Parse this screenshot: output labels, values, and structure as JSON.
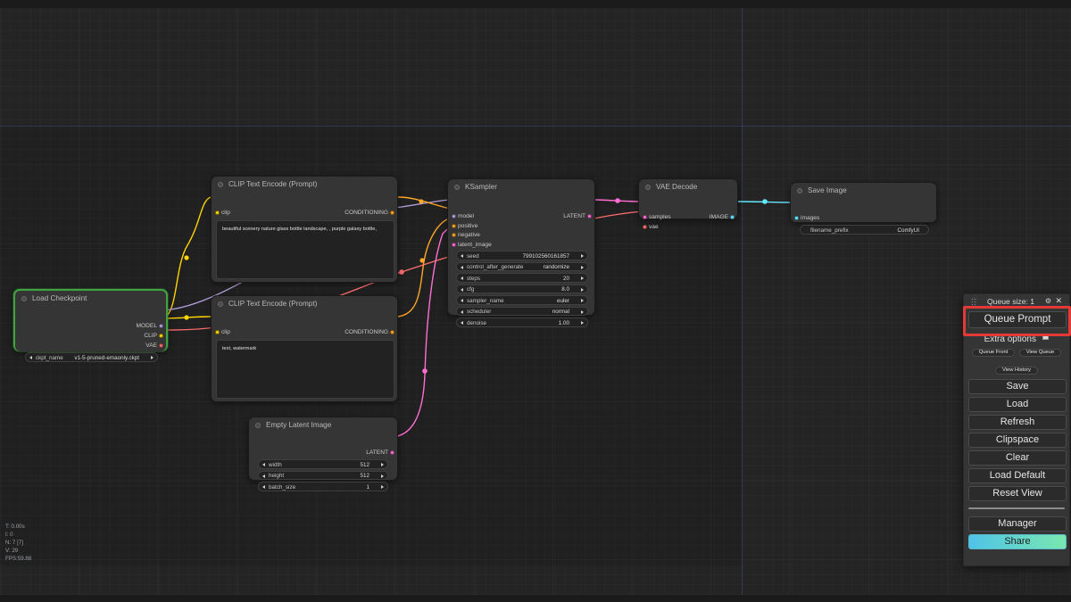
{
  "app": {
    "name": "ComfyUI"
  },
  "canvas": {
    "status": {
      "time": "T: 0.00s",
      "iterations": "I: 0",
      "nodes": "N: 7 [7]",
      "version": "V: 29",
      "fps": "FPS:59.88"
    }
  },
  "colors": {
    "model_link": "#b39ddb",
    "clip_link": "#ffd500",
    "vae_link": "#ff6e6e",
    "conditioning_link": "#ffa726",
    "latent_link": "#ff6ed4",
    "image_link": "#64e8ff",
    "selection": "#3fa33f",
    "highlight": "#e53935",
    "share_gradient_from": "#4fc3e8",
    "share_gradient_to": "#79e8b0"
  },
  "nodes": {
    "load_checkpoint": {
      "title": "Load Checkpoint",
      "outputs": [
        {
          "label": "MODEL",
          "color": "#b39ddb"
        },
        {
          "label": "CLIP",
          "color": "#ffd500"
        },
        {
          "label": "VAE",
          "color": "#ff6e6e"
        }
      ],
      "widgets": [
        {
          "label": "ckpt_name",
          "value": "v1-5-pruned-emaonly.ckpt"
        }
      ]
    },
    "clip_positive": {
      "title": "CLIP Text Encode (Prompt)",
      "inputs": [
        {
          "label": "clip",
          "color": "#ffd500"
        }
      ],
      "outputs": [
        {
          "label": "CONDITIONING",
          "color": "#ffa726"
        }
      ],
      "text": "beautiful scenery nature glass bottle landscape, , purple galaxy bottle,"
    },
    "clip_negative": {
      "title": "CLIP Text Encode (Prompt)",
      "inputs": [
        {
          "label": "clip",
          "color": "#ffd500"
        }
      ],
      "outputs": [
        {
          "label": "CONDITIONING",
          "color": "#ffa726"
        }
      ],
      "text": "text, watermark"
    },
    "empty_latent": {
      "title": "Empty Latent Image",
      "outputs": [
        {
          "label": "LATENT",
          "color": "#ff6ed4"
        }
      ],
      "widgets": [
        {
          "label": "width",
          "value": "512"
        },
        {
          "label": "height",
          "value": "512"
        },
        {
          "label": "batch_size",
          "value": "1"
        }
      ]
    },
    "ksampler": {
      "title": "KSampler",
      "inputs": [
        {
          "label": "model",
          "color": "#b39ddb"
        },
        {
          "label": "positive",
          "color": "#ffa726"
        },
        {
          "label": "negative",
          "color": "#ffa726"
        },
        {
          "label": "latent_image",
          "color": "#ff6ed4"
        }
      ],
      "outputs": [
        {
          "label": "LATENT",
          "color": "#ff6ed4"
        }
      ],
      "widgets": [
        {
          "label": "seed",
          "value": "799102560161857"
        },
        {
          "label": "control_after_generate",
          "value": "randomize"
        },
        {
          "label": "steps",
          "value": "20"
        },
        {
          "label": "cfg",
          "value": "8.0"
        },
        {
          "label": "sampler_name",
          "value": "euler"
        },
        {
          "label": "scheduler",
          "value": "normal"
        },
        {
          "label": "denoise",
          "value": "1.00"
        }
      ]
    },
    "vae_decode": {
      "title": "VAE Decode",
      "inputs": [
        {
          "label": "samples",
          "color": "#ff6ed4"
        },
        {
          "label": "vae",
          "color": "#ff6e6e"
        }
      ],
      "outputs": [
        {
          "label": "IMAGE",
          "color": "#64e8ff"
        }
      ]
    },
    "save_image": {
      "title": "Save Image",
      "inputs": [
        {
          "label": "images",
          "color": "#64e8ff"
        }
      ],
      "widgets": [
        {
          "label": "filename_prefix",
          "value": "ComfyUI"
        }
      ]
    }
  },
  "menu": {
    "queue_size": "Queue size: 1",
    "gear_icon": "gear-icon",
    "close_icon": "close-icon",
    "queue_prompt": "Queue Prompt",
    "extra_options": "Extra options",
    "queue_front": "Queue Front",
    "view_queue": "View Queue",
    "view_history": "View History",
    "save": "Save",
    "load": "Load",
    "refresh": "Refresh",
    "clipspace": "Clipspace",
    "clear": "Clear",
    "load_default": "Load Default",
    "reset_view": "Reset View",
    "manager": "Manager",
    "share": "Share"
  }
}
